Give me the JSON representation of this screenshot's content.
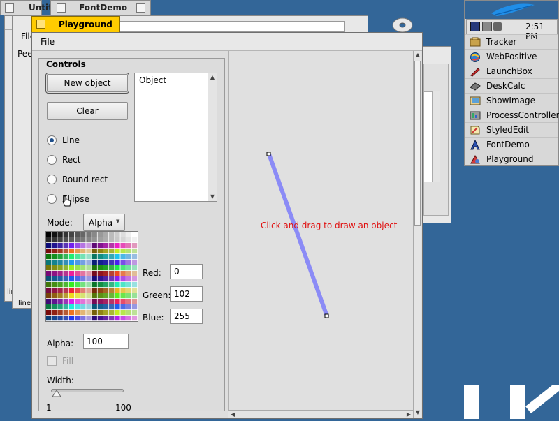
{
  "background_windows": {
    "untitled_title": "Untitl",
    "fontdemo_title": "FontDemo",
    "file_menu": "File",
    "peek_text": "Pee",
    "line_label_1": "lin",
    "line_label_2": "line"
  },
  "window": {
    "title": "Playground",
    "menu": {
      "file": "File"
    }
  },
  "controls": {
    "title": "Controls",
    "new_object_button": "New object",
    "clear_button": "Clear",
    "object_list_header": "Object",
    "shape_options": [
      {
        "label": "Line",
        "selected": true
      },
      {
        "label": "Rect",
        "selected": false
      },
      {
        "label": "Round rect",
        "selected": false
      },
      {
        "label": "Ellipse",
        "selected": false
      }
    ],
    "mode_label": "Mode:",
    "mode_value": "Alpha",
    "red_label": "Red:",
    "red_value": "0",
    "green_label": "Green:",
    "green_value": "102",
    "blue_label": "Blue:",
    "blue_value": "255",
    "alpha_label": "Alpha:",
    "alpha_value": "100",
    "fill_label": "Fill",
    "fill_checked": false,
    "width_label": "Width:",
    "width_min": "1",
    "width_max": "100",
    "width_value": 1
  },
  "canvas": {
    "hint": "Click and drag to draw an object",
    "line_color": "#6666ff",
    "hint_color": "#e01010"
  },
  "deskbar": {
    "clock": "2:51 PM",
    "apps": [
      {
        "name": "Tracker",
        "icon": "tracker-icon"
      },
      {
        "name": "WebPositive",
        "icon": "webpositive-icon"
      },
      {
        "name": "LaunchBox",
        "icon": "launchbox-icon"
      },
      {
        "name": "DeskCalc",
        "icon": "deskcalc-icon"
      },
      {
        "name": "ShowImage",
        "icon": "showimage-icon"
      },
      {
        "name": "ProcessController",
        "icon": "processcontroller-icon"
      },
      {
        "name": "StyledEdit",
        "icon": "stylededit-icon"
      },
      {
        "name": "FontDemo",
        "icon": "fontdemo-icon"
      },
      {
        "name": "Playground",
        "icon": "playground-icon"
      }
    ]
  },
  "colors": {
    "desktop": "#336698",
    "title_tab_active": "#ffcb00",
    "radio_selected": "#1f4f8b"
  }
}
